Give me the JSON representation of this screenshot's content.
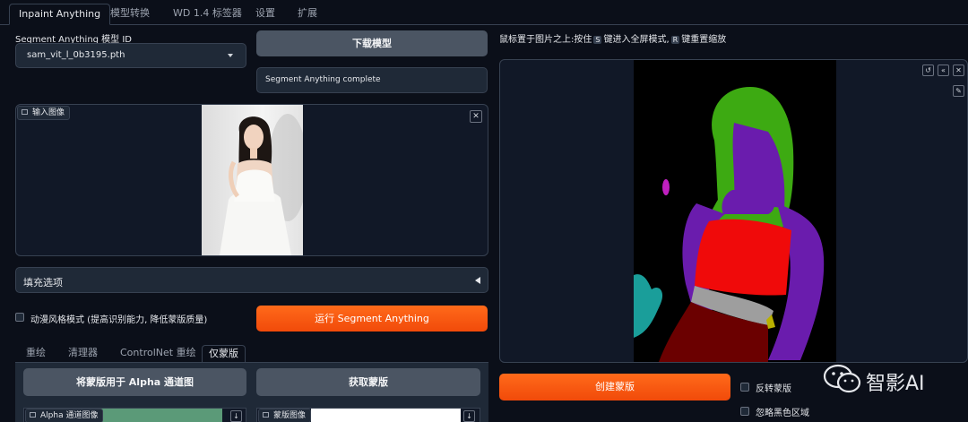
{
  "tabs": [
    "Inpaint Anything",
    "模型转换",
    "WD 1.4 标签器",
    "设置",
    "扩展"
  ],
  "left": {
    "model_label": "Segment Anything 模型 ID",
    "model_value": "sam_vit_l_0b3195.pth",
    "download_button": "下载模型",
    "status_text": "Segment Anything complete",
    "input_image_label": "输入图像",
    "fill_options_label": "填充选项",
    "anime_checkbox_label": "动漫风格模式 (提高识别能力, 降低蒙版质量)",
    "run_button": "运行 Segment Anything",
    "subtabs": [
      "重绘",
      "清理器",
      "ControlNet 重绘",
      "仅蒙版"
    ],
    "alpha_button": "将蒙版用于 Alpha 通道图",
    "get_mask_button": "获取蒙版",
    "alpha_image_label": "Alpha 通道图像",
    "mask_image_label": "蒙版图像"
  },
  "right": {
    "hint_part1": "鼠标置于图片之上:按住",
    "hint_key1": "S",
    "hint_part2": "键进入全屏模式,",
    "hint_key2": "R",
    "hint_part3": "键重置缩放",
    "create_mask_button": "创建蒙版",
    "invert_mask_label": "反转蒙版",
    "ignore_black_label": "忽略黑色区域"
  },
  "watermark": {
    "text": "智影AI",
    "icon": "wechat-icon"
  },
  "colors": {
    "accent": "#ff5a10",
    "background": "#0b0f19",
    "panel": "#1f2937"
  }
}
